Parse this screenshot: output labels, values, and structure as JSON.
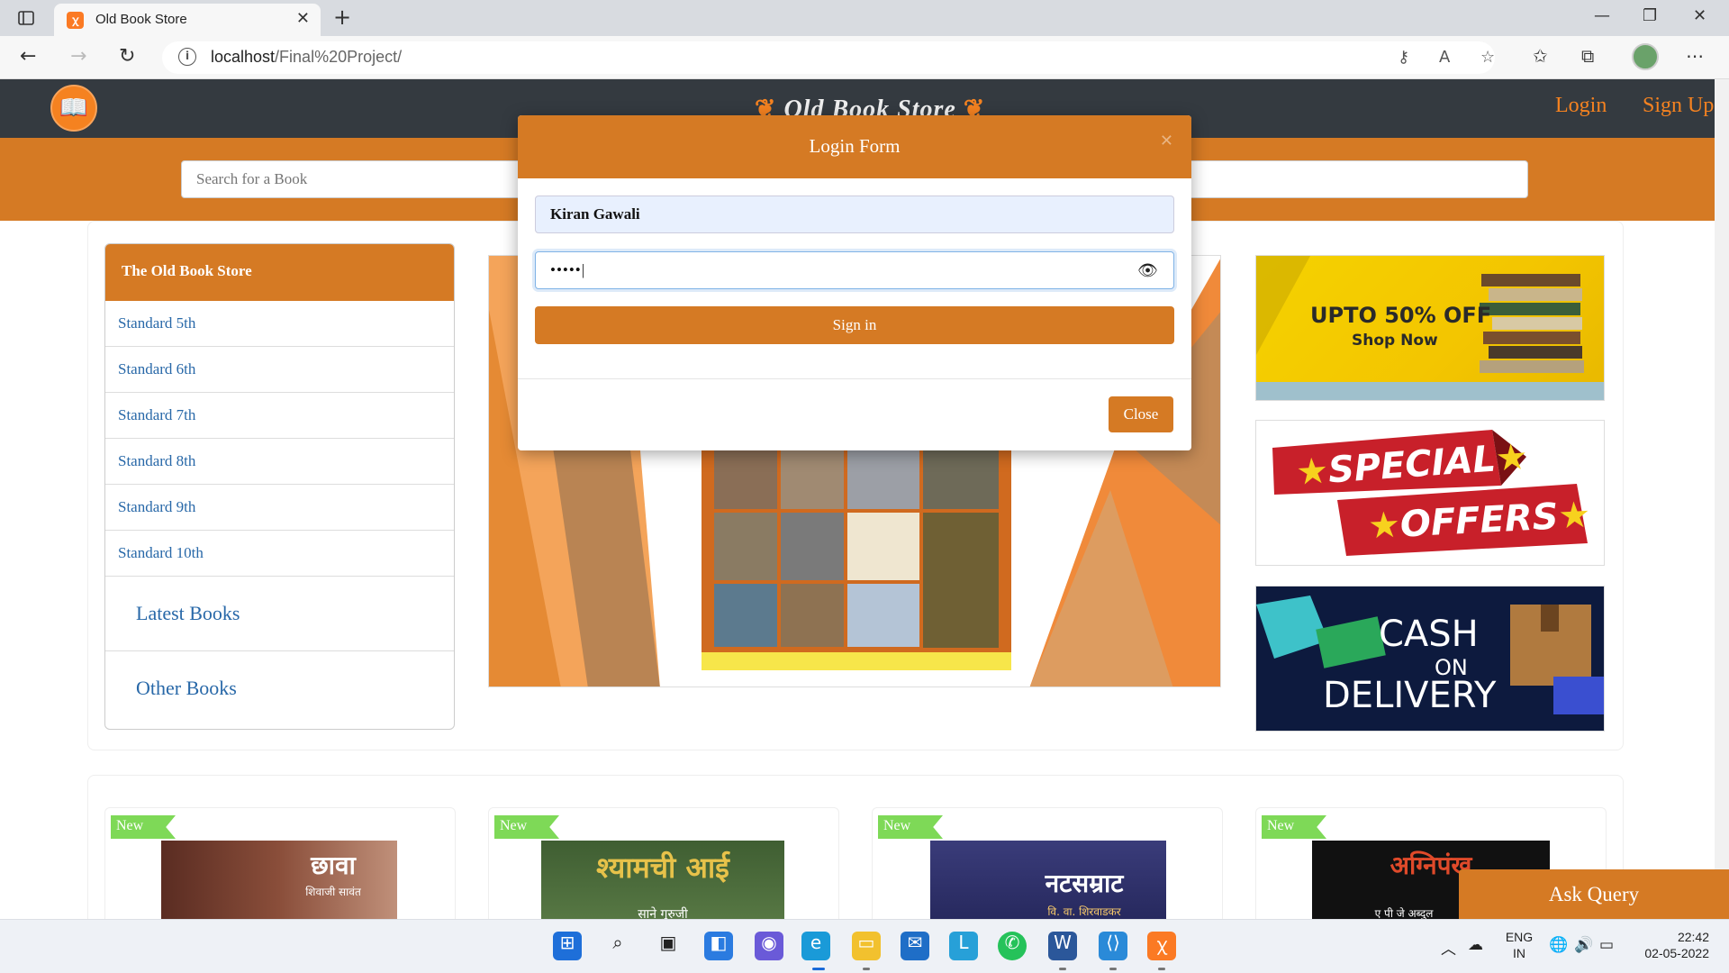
{
  "browser": {
    "tab_title": "Old Book Store",
    "url_host": "localhost",
    "url_path": "/Final%20Project/"
  },
  "site": {
    "brand": "Old Book Store",
    "login_link": "Login",
    "signup_link": "Sign Up",
    "search_placeholder": "Search for a Book"
  },
  "sidebar": {
    "title": "The Old Book Store",
    "items": [
      "Standard 5th",
      "Standard 6th",
      "Standard 7th",
      "Standard 8th",
      "Standard 9th",
      "Standard 10th"
    ],
    "latest": "Latest Books",
    "other": "Other Books"
  },
  "ads": {
    "ad1_line1": "UPTO 50% OFF",
    "ad1_line2": "Shop Now",
    "ad2_line1": "SPECIAL",
    "ad2_line2": "OFFERS",
    "ad3_line1": "CASH",
    "ad3_line2": "ON",
    "ad3_line3": "DELIVERY"
  },
  "products": [
    {
      "badge": "New",
      "title": "छावा",
      "author": "शिवाजी सावंत"
    },
    {
      "badge": "New",
      "title": "श्यामची आई",
      "author": "साने गुरुजी"
    },
    {
      "badge": "New",
      "title": "नटसम्राट",
      "author": "वि. वा. शिरवाडकर"
    },
    {
      "badge": "New",
      "title": "अग्निपंख",
      "author": "ए पी जे अब्दुल"
    }
  ],
  "ask_query": "Ask Query",
  "modal": {
    "title": "Login Form",
    "username": "Kiran Gawali",
    "password_mask": "•••••",
    "signin": "Sign in",
    "close": "Close"
  },
  "taskbar": {
    "lang1": "ENG",
    "lang2": "IN",
    "time": "22:42",
    "date": "02-05-2022"
  },
  "colors": {
    "accent": "#d57a24",
    "nav_bg": "#343a40",
    "link": "#2868a8",
    "badge": "#7ed957"
  }
}
